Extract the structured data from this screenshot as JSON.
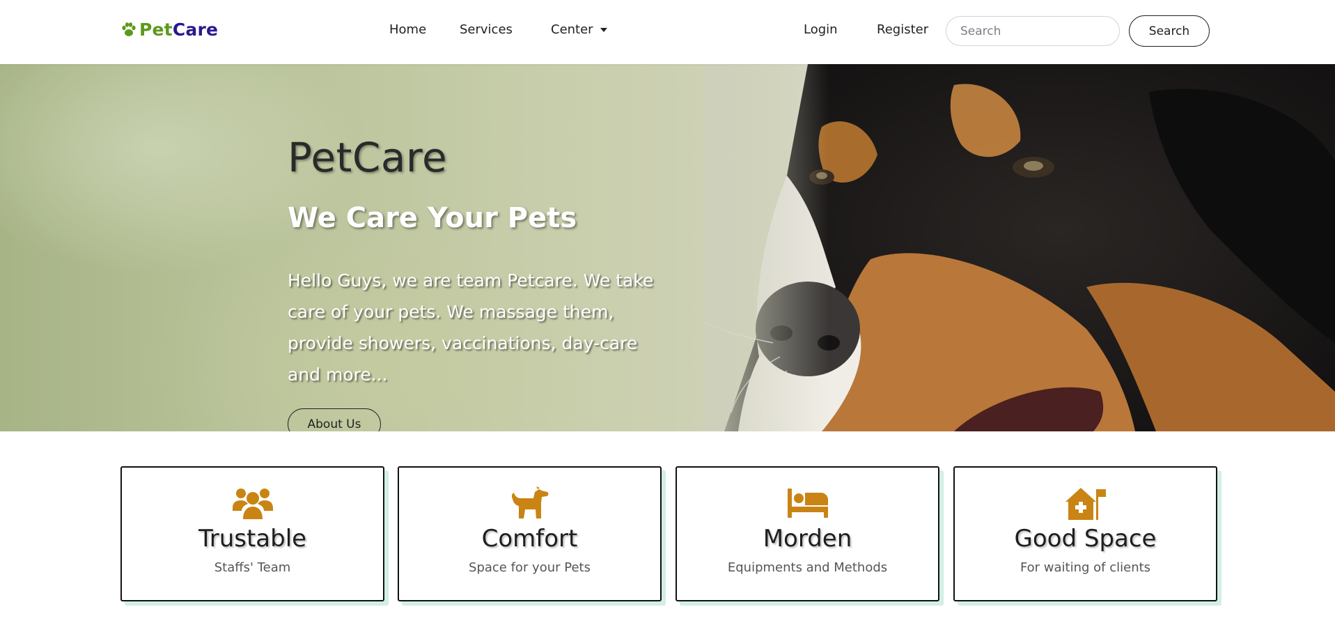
{
  "navbar": {
    "brand_pet": "Pet",
    "brand_care": "Care",
    "links": {
      "home": "Home",
      "services": "Services",
      "center": "Center",
      "login": "Login",
      "register": "Register"
    },
    "search_placeholder": "Search",
    "search_button": "Search"
  },
  "hero": {
    "title": "PetCare",
    "subtitle": "We Care Your Pets",
    "text": "Hello Guys, we are team Petcare. We take care of your pets. We massage them, provide showers, vaccinations, day-care and more...",
    "button": "About Us"
  },
  "features": [
    {
      "icon": "users-icon",
      "title": "Trustable",
      "subtitle": "Staffs' Team"
    },
    {
      "icon": "dog-icon",
      "title": "Comfort",
      "subtitle": "Space for your Pets"
    },
    {
      "icon": "bed-icon",
      "title": "Morden",
      "subtitle": "Equipments and Methods"
    },
    {
      "icon": "clinic-house-icon",
      "title": "Good Space",
      "subtitle": "For waiting of clients"
    }
  ],
  "colors": {
    "brand_green": "#5c9a1a",
    "brand_purple": "#2a1a8c",
    "icon_orange": "#c98413",
    "card_shadow": "#d2eee5"
  }
}
